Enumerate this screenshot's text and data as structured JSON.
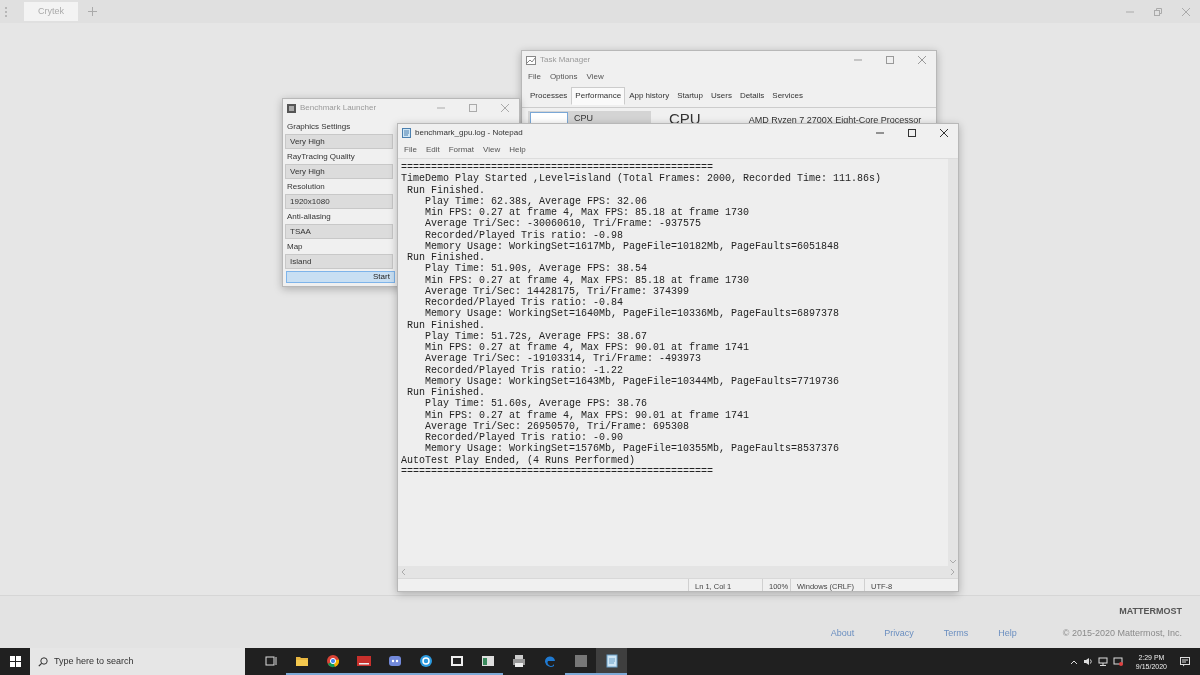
{
  "app_window": {
    "tabs": [
      {
        "title": "Crytek",
        "selected": true
      }
    ]
  },
  "task_manager": {
    "title": "Task Manager",
    "menu": [
      "File",
      "Options",
      "View"
    ],
    "tabs": [
      {
        "label": "Processes",
        "selected": false
      },
      {
        "label": "Performance",
        "selected": true
      },
      {
        "label": "App history",
        "selected": false
      },
      {
        "label": "Startup",
        "selected": false
      },
      {
        "label": "Users",
        "selected": false
      },
      {
        "label": "Details",
        "selected": false
      },
      {
        "label": "Services",
        "selected": false
      }
    ],
    "sidebar_item": {
      "label": "CPU",
      "selected": true
    },
    "heading": "CPU",
    "processor": "AMD Ryzen 7 2700X Eight-Core Processor"
  },
  "benchmark_launcher": {
    "title": "Benchmark Launcher",
    "fields": [
      {
        "label": "Graphics Settings",
        "value": "Very High"
      },
      {
        "label": "RayTracing Quality",
        "value": "Very High"
      },
      {
        "label": "Resolution",
        "value": "1920x1080"
      },
      {
        "label": "Anti-aliasing",
        "value": "TSAA"
      },
      {
        "label": "Map",
        "value": "Island"
      }
    ],
    "button": "Start"
  },
  "notepad": {
    "title": "benchmark_gpu.log - Notepad",
    "menu": [
      "File",
      "Edit",
      "Format",
      "View",
      "Help"
    ],
    "lines": [
      "====================================================",
      "TimeDemo Play Started ,Level=island (Total Frames: 2000, Recorded Time: 111.86s)",
      " Run Finished.",
      "    Play Time: 62.38s, Average FPS: 32.06",
      "    Min FPS: 0.27 at frame 4, Max FPS: 85.18 at frame 1730",
      "    Average Tri/Sec: -30060610, Tri/Frame: -937575",
      "    Recorded/Played Tris ratio: -0.98",
      "    Memory Usage: WorkingSet=1617Mb, PageFile=10182Mb, PageFaults=6051848",
      " Run Finished.",
      "    Play Time: 51.90s, Average FPS: 38.54",
      "    Min FPS: 0.27 at frame 4, Max FPS: 85.18 at frame 1730",
      "    Average Tri/Sec: 14428175, Tri/Frame: 374399",
      "    Recorded/Played Tris ratio: -0.84",
      "    Memory Usage: WorkingSet=1640Mb, PageFile=10336Mb, PageFaults=6897378",
      " Run Finished.",
      "    Play Time: 51.72s, Average FPS: 38.67",
      "    Min FPS: 0.27 at frame 4, Max FPS: 90.01 at frame 1741",
      "    Average Tri/Sec: -19103314, Tri/Frame: -493973",
      "    Recorded/Played Tris ratio: -1.22",
      "    Memory Usage: WorkingSet=1643Mb, PageFile=10344Mb, PageFaults=7719736",
      " Run Finished.",
      "    Play Time: 51.60s, Average FPS: 38.76",
      "    Min FPS: 0.27 at frame 4, Max FPS: 90.01 at frame 1741",
      "    Average Tri/Sec: 26950570, Tri/Frame: 695308",
      "    Recorded/Played Tris ratio: -0.90",
      "    Memory Usage: WorkingSet=1576Mb, PageFile=10355Mb, PageFaults=8537376",
      "AutoTest Play Ended, (4 Runs Performed)",
      "===================================================="
    ],
    "status": [
      "Ln 1, Col 1",
      "100%",
      "Windows (CRLF)",
      "UTF-8"
    ]
  },
  "footer": {
    "brand": "MATTERMOST",
    "links": [
      "About",
      "Privacy",
      "Terms",
      "Help"
    ],
    "copyright": "© 2015-2020 Mattermost, Inc."
  },
  "taskbar": {
    "search_placeholder": "Type here to search",
    "apps": [
      {
        "kind": "taskview",
        "running": false,
        "selected": false
      },
      {
        "kind": "folder",
        "running": true,
        "selected": false
      },
      {
        "kind": "chrome",
        "running": true,
        "selected": false
      },
      {
        "kind": "game",
        "running": true,
        "selected": false
      },
      {
        "kind": "chat",
        "running": true,
        "selected": false
      },
      {
        "kind": "ring",
        "running": true,
        "selected": false
      },
      {
        "kind": "archive",
        "running": true,
        "selected": false
      },
      {
        "kind": "window",
        "running": true,
        "selected": false
      },
      {
        "kind": "printer",
        "running": false,
        "selected": false
      },
      {
        "kind": "edge",
        "running": false,
        "selected": false
      },
      {
        "kind": "photo",
        "running": true,
        "selected": false
      },
      {
        "kind": "notepad",
        "running": true,
        "selected": true
      }
    ],
    "time": "2:29 PM",
    "date": "9/15/2020"
  }
}
